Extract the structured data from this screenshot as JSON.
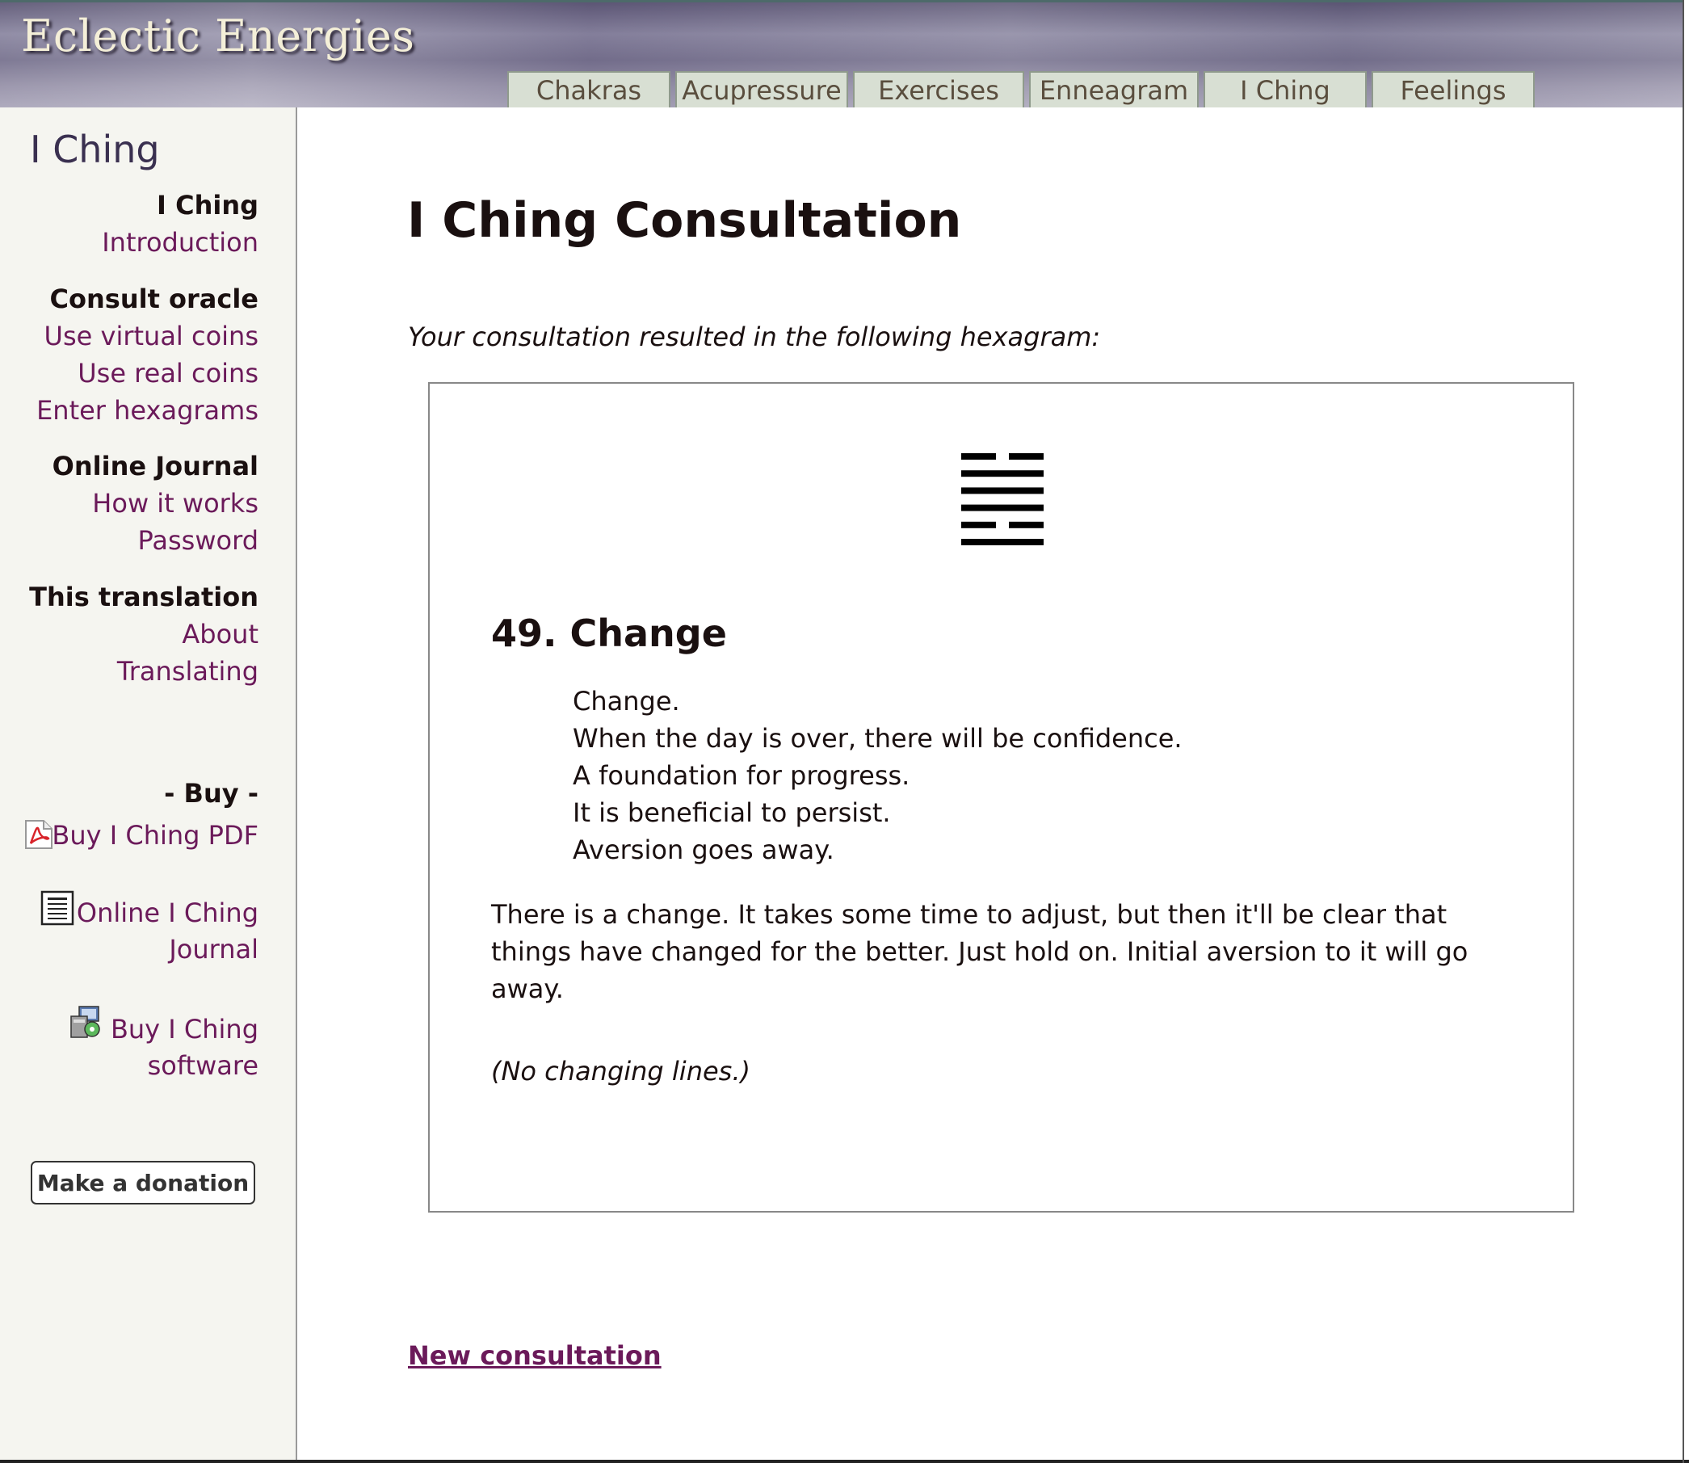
{
  "header": {
    "site_title": "Eclectic Energies",
    "tabs": [
      {
        "label": "Chakras"
      },
      {
        "label": "Acupressure"
      },
      {
        "label": "Exercises"
      },
      {
        "label": "Enneagram"
      },
      {
        "label": "I Ching"
      },
      {
        "label": "Feelings"
      }
    ]
  },
  "sidebar": {
    "title": "I Ching",
    "groups": [
      {
        "heading": "I Ching",
        "links": [
          "Introduction"
        ]
      },
      {
        "heading": "Consult oracle",
        "links": [
          "Use virtual coins",
          "Use real coins",
          "Enter hexagrams"
        ]
      },
      {
        "heading": "Online Journal",
        "links": [
          "How it works",
          "Password"
        ]
      },
      {
        "heading": "This translation",
        "links": [
          "About",
          "Translating"
        ]
      }
    ],
    "buy_heading": "- Buy -",
    "buy_items": [
      {
        "lines": [
          "Buy I Ching PDF"
        ],
        "icon": "pdf-icon"
      },
      {
        "lines": [
          "Online I Ching",
          "Journal"
        ],
        "icon": "journal-icon"
      },
      {
        "lines": [
          "Buy I Ching",
          "software"
        ],
        "icon": "software-icon"
      }
    ],
    "donate_label": "Make a donation"
  },
  "main": {
    "title": "I Ching Consultation",
    "intro": "Your consultation resulted in the following hexagram:",
    "hexagram": {
      "number_title": "49. Change",
      "lines_top_to_bottom": [
        "broken",
        "solid",
        "solid",
        "solid",
        "broken",
        "solid"
      ],
      "judgement": [
        "Change.",
        "When the day is over, there will be confidence.",
        "A foundation for progress.",
        "It is beneficial to persist.",
        "Aversion goes away."
      ],
      "commentary": "There is a change. It takes some time to adjust, but then it'll be clear that things have changed for the better. Just hold on. Initial aversion to it will go away.",
      "changing_lines_note": "(No changing lines.)"
    },
    "new_consultation_label": "New consultation"
  },
  "colors": {
    "link": "#6b1a5a",
    "tab_bg": "#d8dfd3",
    "sidebar_bg": "#f5f5f0",
    "title_text": "#f4efd8"
  }
}
